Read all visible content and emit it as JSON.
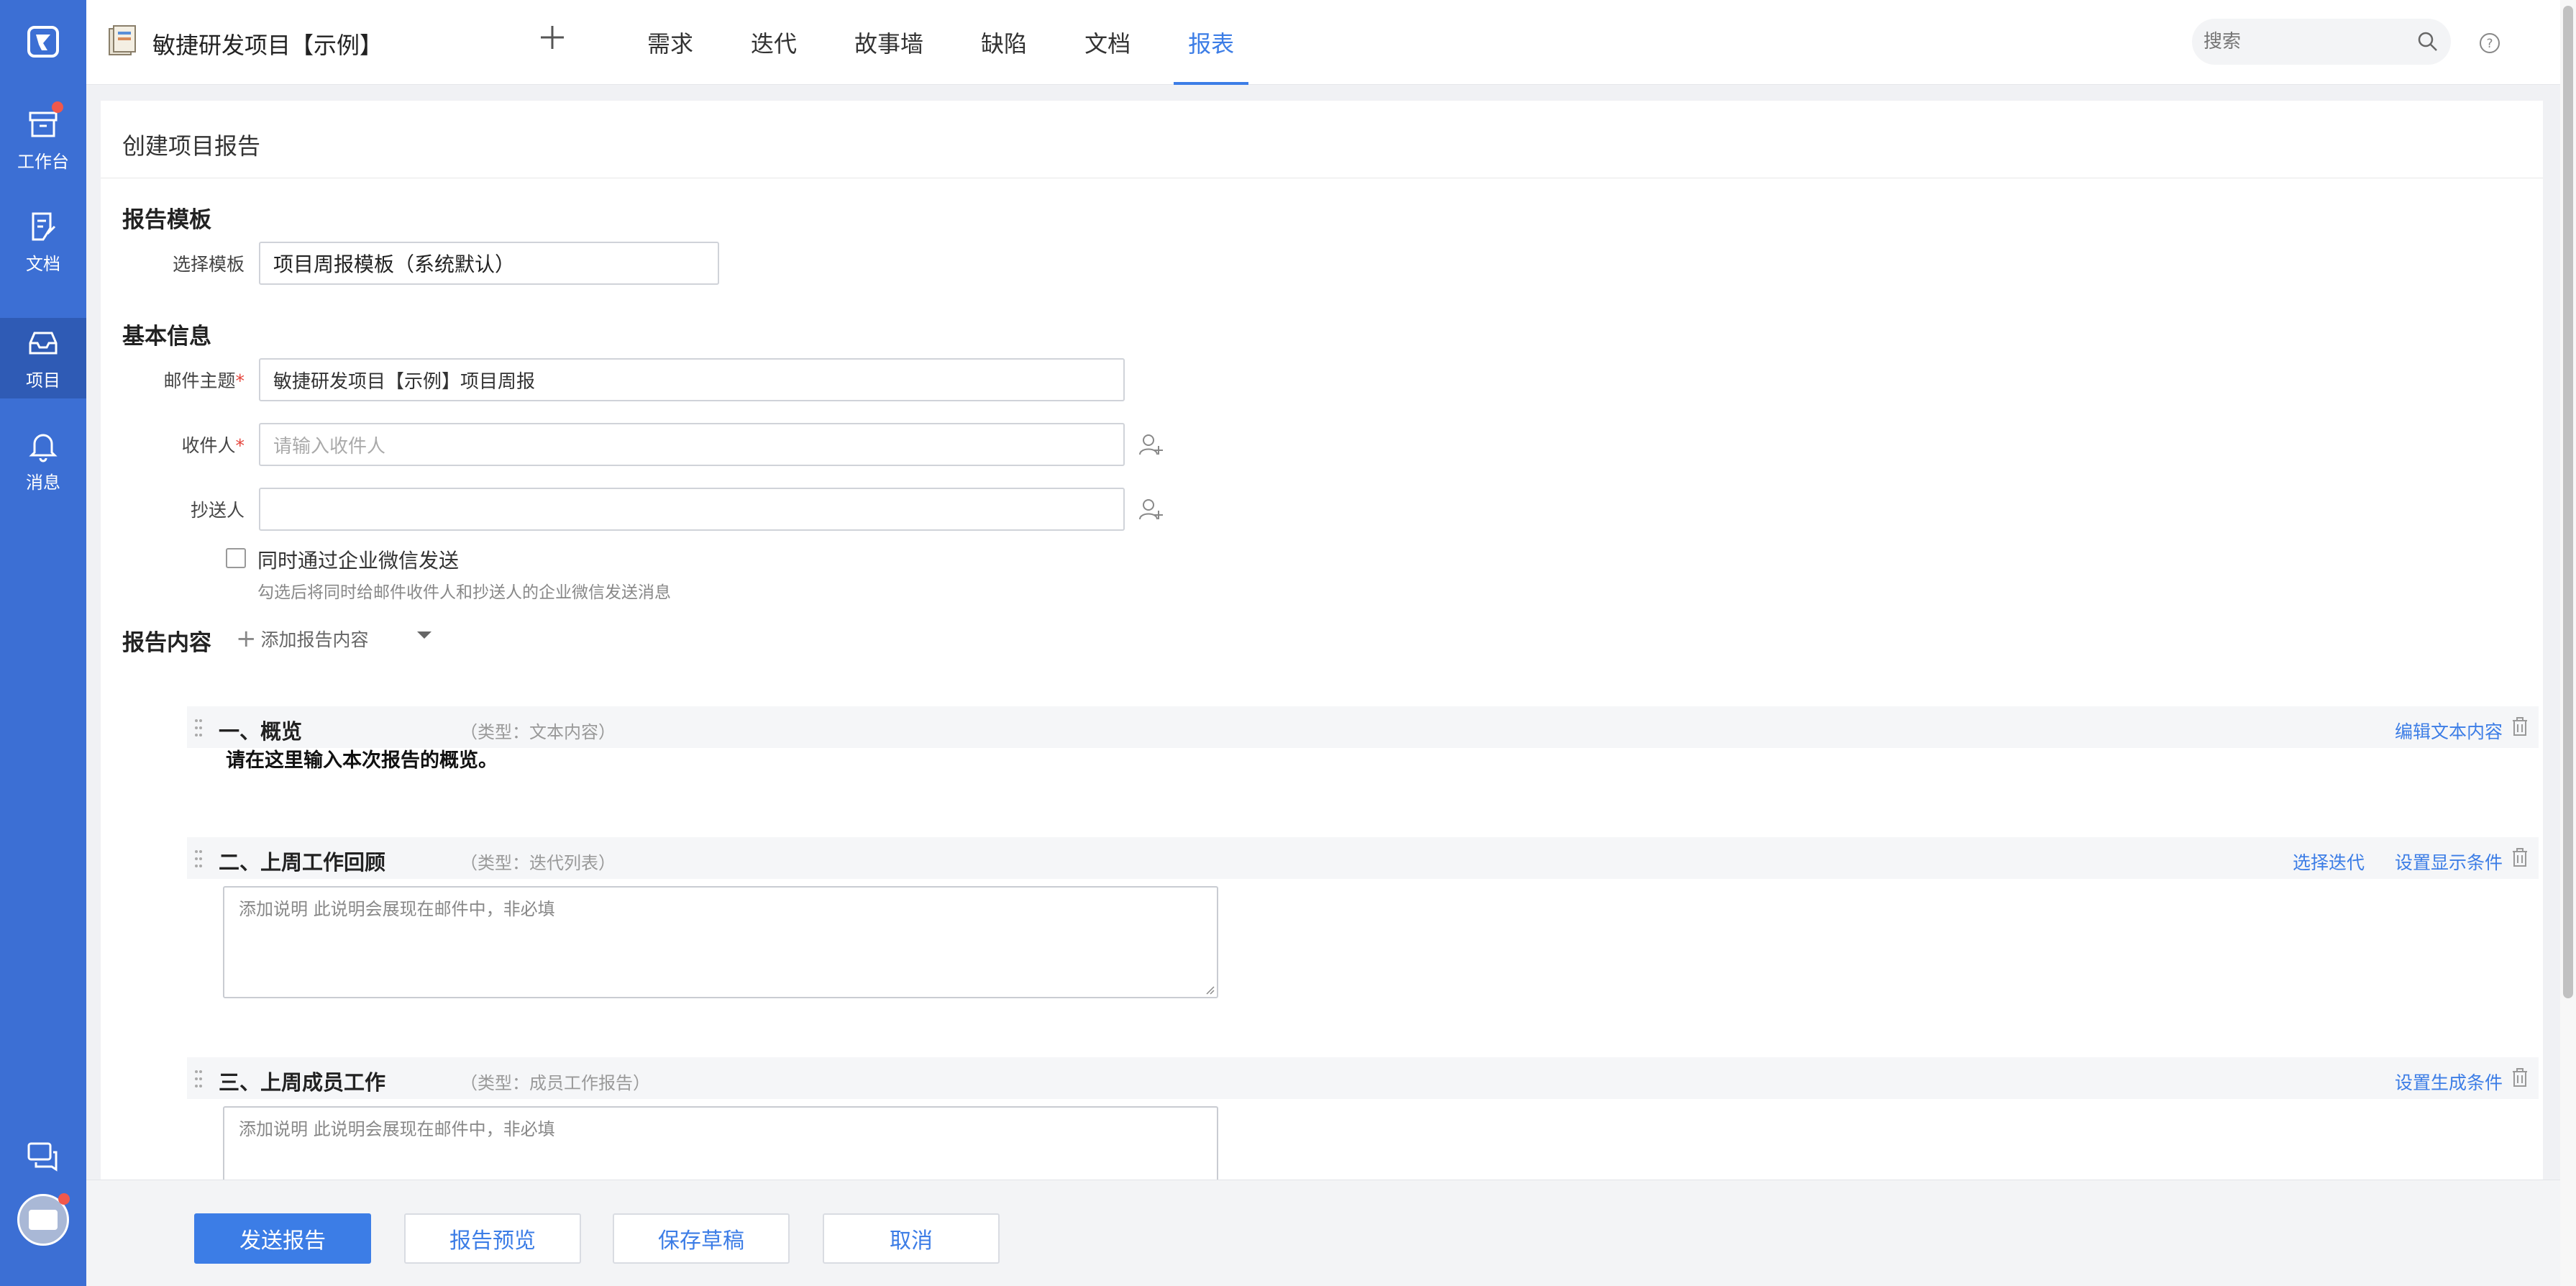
{
  "sidebar": {
    "items": [
      {
        "label": "工作台",
        "icon": "archive-box-icon",
        "has_badge": true
      },
      {
        "label": "文档",
        "icon": "document-edit-icon"
      },
      {
        "label": "项目",
        "icon": "inbox-tray-icon",
        "active": true
      },
      {
        "label": "消息",
        "icon": "bell-icon"
      }
    ],
    "bottom_icons": [
      "chat-bubbles-icon",
      "user-avatar"
    ]
  },
  "header": {
    "project_title": "敏捷研发项目【示例】",
    "tabs": [
      {
        "label": "需求"
      },
      {
        "label": "迭代"
      },
      {
        "label": "故事墙"
      },
      {
        "label": "缺陷"
      },
      {
        "label": "文档"
      },
      {
        "label": "报表",
        "active": true
      }
    ],
    "search": {
      "placeholder": "搜索"
    }
  },
  "panel": {
    "title": "创建项目报告",
    "template_section": {
      "title": "报告模板",
      "select_label": "选择模板",
      "selected_template": "项目周报模板（系统默认）"
    },
    "basic_info": {
      "title": "基本信息",
      "subject_label": "邮件主题",
      "subject_required_mark": "*",
      "subject_value": "敏捷研发项目【示例】项目周报",
      "recipient_label": "收件人",
      "recipient_required_mark": "*",
      "recipient_placeholder": "请输入收件人",
      "cc_label": "抄送人",
      "cc_value": "",
      "wechat_checkbox_label": "同时通过企业微信发送",
      "wechat_hint": "勾选后将同时给邮件收件人和抄送人的企业微信发送消息"
    },
    "content": {
      "title": "报告内容",
      "add_label": "添加报告内容",
      "blocks": [
        {
          "title": "一、概览",
          "type": "（类型：文本内容）",
          "actions": [
            "编辑文本内容"
          ],
          "body_text": "请在这里输入本次报告的概览。"
        },
        {
          "title": "二、上周工作回顾",
          "type": "（类型：迭代列表）",
          "actions": [
            "选择迭代",
            "设置显示条件"
          ],
          "placeholder": "添加说明 此说明会展现在邮件中，非必填"
        },
        {
          "title": "三、上周成员工作",
          "type": "（类型：成员工作报告）",
          "actions": [
            "设置生成条件"
          ],
          "placeholder": "添加说明 此说明会展现在邮件中，非必填"
        }
      ]
    }
  },
  "footer": {
    "send_label": "发送报告",
    "preview_label": "报告预览",
    "draft_label": "保存草稿",
    "cancel_label": "取消"
  },
  "colors": {
    "sidebar_bg": "#3c6fd4",
    "sidebar_active": "#2f5bb5",
    "accent": "#3c7de6",
    "badge": "#f0584c",
    "required": "#e5443b"
  }
}
